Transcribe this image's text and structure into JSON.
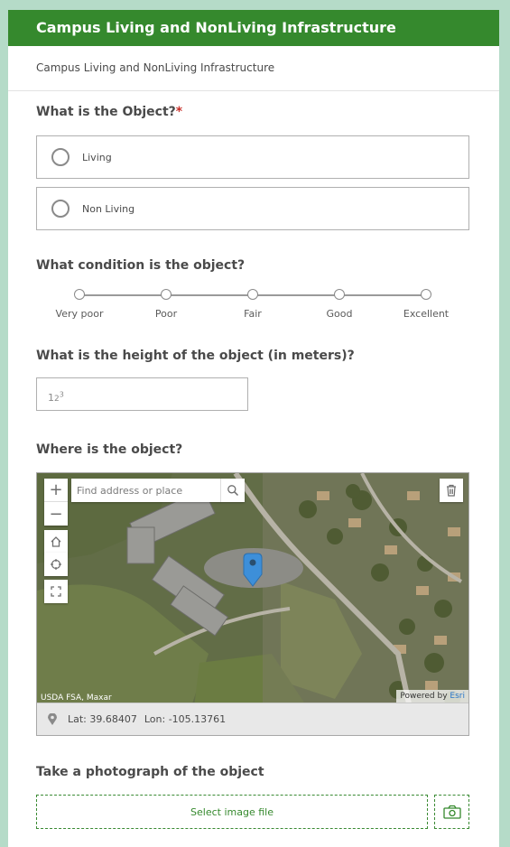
{
  "header": {
    "title": "Campus Living and NonLiving Infrastructure",
    "description": "Campus Living and NonLiving Infrastructure",
    "color": "#35892d"
  },
  "q1": {
    "label": "What is the Object?",
    "required_mark": "*",
    "options": [
      "Living",
      "Non Living"
    ]
  },
  "q2": {
    "label": "What condition is the object?",
    "scale": [
      "Very poor",
      "Poor",
      "Fair",
      "Good",
      "Excellent"
    ]
  },
  "q3": {
    "label": "What is the height of the object (in meters)?",
    "placeholder_icon": "123"
  },
  "q4": {
    "label": "Where is the object?",
    "search_placeholder": "Find address or place",
    "attribution_left": "USDA FSA, Maxar",
    "attribution_powered": "Powered by",
    "attribution_esri": "Esri",
    "lat": "Lat: 39.68407",
    "lon": "Lon: -105.13761",
    "icons": [
      "zoom-in-icon",
      "zoom-out-icon",
      "home-icon",
      "locate-icon",
      "fullscreen-icon",
      "search-icon",
      "trash-icon",
      "location-pin-icon"
    ]
  },
  "q5": {
    "label": "Take a photograph of the object",
    "select_label": "Select image file",
    "camera_icon": "camera-icon"
  }
}
